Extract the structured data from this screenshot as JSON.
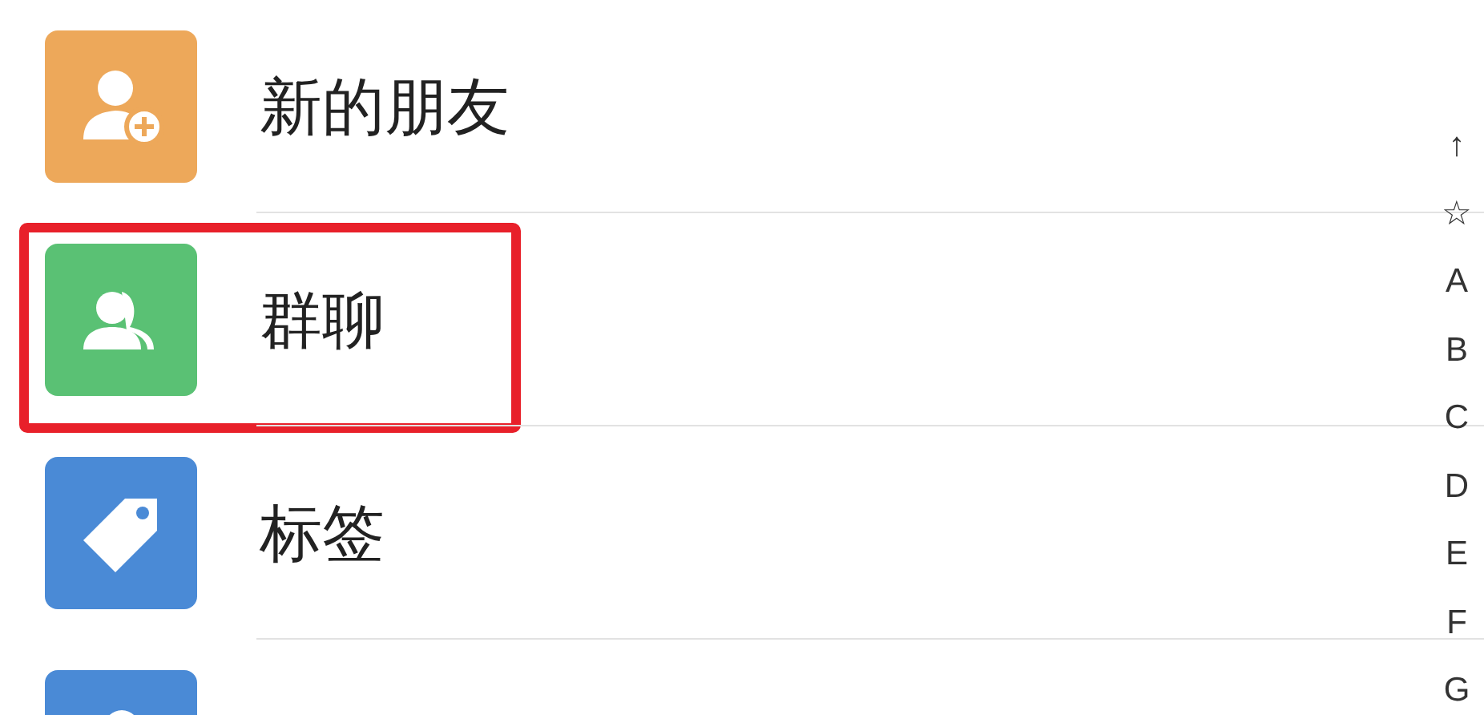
{
  "entries": [
    {
      "kind": "new-friend",
      "label": "新的朋友",
      "highlighted": false
    },
    {
      "kind": "group",
      "label": "群聊",
      "highlighted": true
    },
    {
      "kind": "tag",
      "label": "标签",
      "highlighted": false
    },
    {
      "kind": "person",
      "highlighted": false
    }
  ],
  "index_bar": [
    "↑",
    "☆",
    "A",
    "B",
    "C",
    "D",
    "E",
    "F",
    "G"
  ]
}
